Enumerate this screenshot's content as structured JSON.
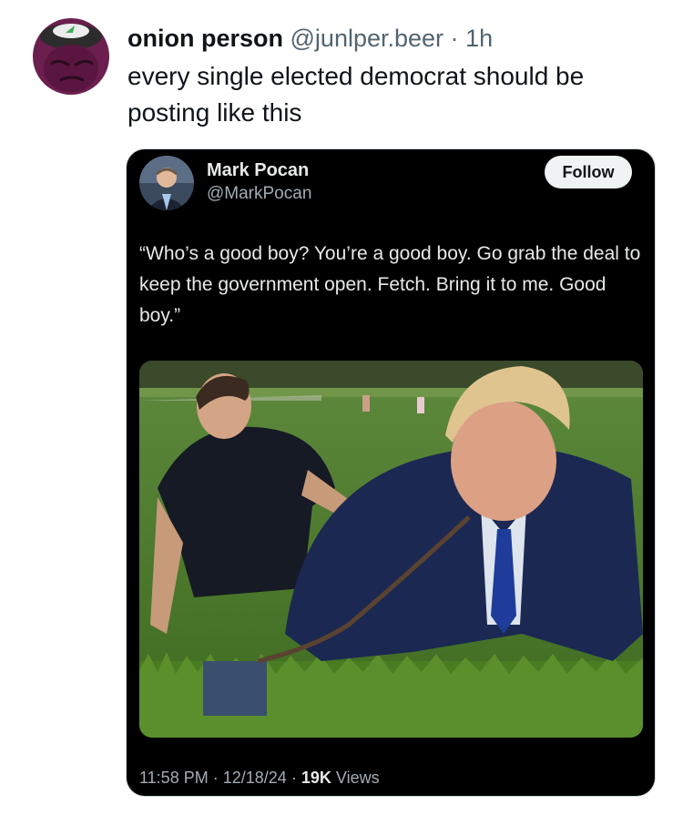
{
  "post": {
    "display_name": "onion person",
    "handle": "@junlper.beer",
    "separator": "·",
    "time": "1h",
    "text": "every single elected democrat should be posting like this",
    "avatar_icon": "purple-onion-character-avatar"
  },
  "embed": {
    "display_name": "Mark Pocan",
    "handle": "@MarkPocan",
    "follow_label": "Follow",
    "text": "“Who’s a good boy? You’re a good boy. Go grab the deal to keep the government open. Fetch. Bring it to me. Good boy.”",
    "image_icon": "photo-two-men-on-grass-leash",
    "meta": {
      "time": "11:58 PM",
      "sep1": "·",
      "date": "12/18/24",
      "sep2": "·",
      "views_count": "19K",
      "views_label": "Views"
    }
  },
  "colors": {
    "text_primary": "#0f1419",
    "text_secondary": "#536471",
    "embed_bg": "#000000",
    "avatar_purple": "#6b1f4e"
  }
}
